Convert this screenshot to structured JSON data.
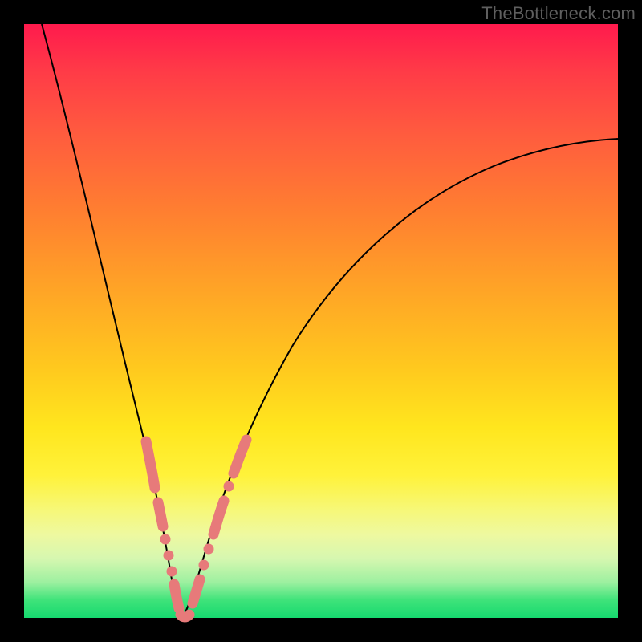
{
  "watermark": "TheBottleneck.com",
  "chart_data": {
    "type": "line",
    "title": "",
    "xlabel": "",
    "ylabel": "",
    "xlim": [
      0,
      100
    ],
    "ylim": [
      0,
      100
    ],
    "grid": false,
    "legend": false,
    "series": [
      {
        "name": "left-branch",
        "x": [
          3,
          6,
          9,
          12,
          14,
          16,
          18,
          19,
          20,
          21,
          22,
          23,
          24,
          25
        ],
        "values": [
          100,
          88,
          76,
          63,
          52,
          42,
          32,
          25,
          18,
          12,
          7,
          3,
          1,
          0
        ]
      },
      {
        "name": "right-branch",
        "x": [
          25,
          26,
          27,
          28,
          30,
          33,
          37,
          42,
          48,
          55,
          63,
          72,
          82,
          92,
          100
        ],
        "values": [
          0,
          1,
          4,
          8,
          15,
          25,
          36,
          46,
          55,
          62,
          68,
          72,
          76,
          79,
          81
        ]
      }
    ],
    "highlighted_beads": {
      "left": {
        "x_start": 19,
        "x_end": 24,
        "count": 7
      },
      "right": {
        "x_start": 26,
        "x_end": 32,
        "count": 6
      },
      "bottom": {
        "x_start": 24,
        "x_end": 26
      }
    },
    "background_gradient": {
      "top": "#ff1a4d",
      "mid": "#ffe61e",
      "bottom": "#16d96f"
    }
  }
}
